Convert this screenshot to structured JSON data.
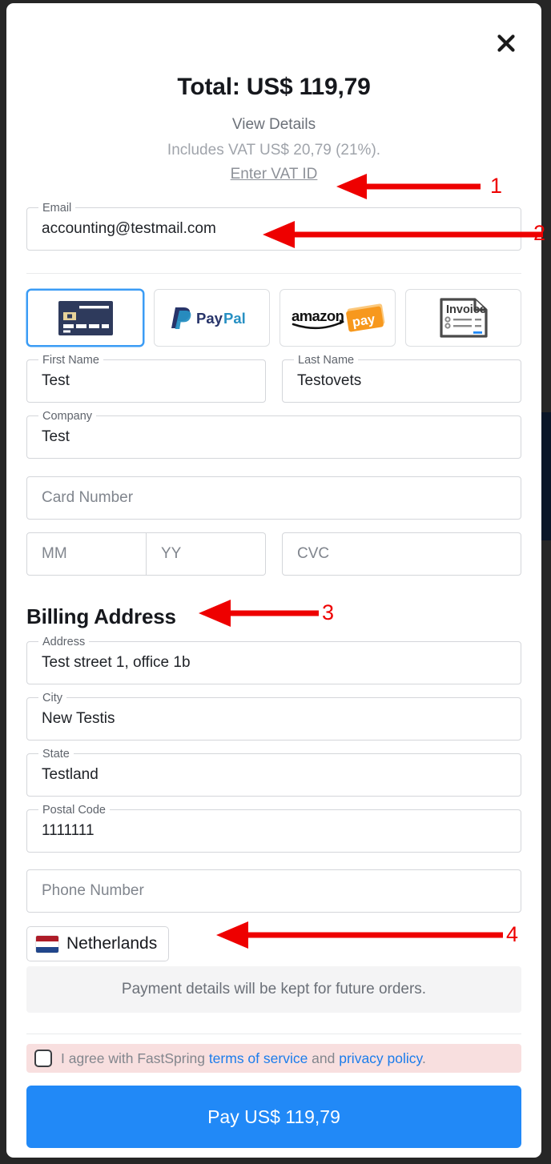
{
  "modal": {
    "close_icon": "close-icon",
    "total_title": "Total: US$ 119,79",
    "view_details": "View Details",
    "vat_line": "Includes VAT US$ 20,79 (21%).",
    "vat_id_link": "Enter VAT ID"
  },
  "email": {
    "label": "Email",
    "value": "accounting@testmail.com"
  },
  "payment_methods": [
    {
      "name": "credit-card",
      "label": "Credit Card",
      "selected": true
    },
    {
      "name": "paypal",
      "label": "PayPal",
      "selected": false
    },
    {
      "name": "amazon-pay",
      "label": "amazon pay",
      "selected": false
    },
    {
      "name": "invoice",
      "label": "Invoice",
      "selected": false
    }
  ],
  "card_form": {
    "first_name": {
      "label": "First Name",
      "value": "Test"
    },
    "last_name": {
      "label": "Last Name",
      "value": "Testovets"
    },
    "company": {
      "label": "Company",
      "value": "Test"
    },
    "card_number": {
      "placeholder": "Card Number",
      "value": ""
    },
    "month": {
      "placeholder": "MM",
      "value": ""
    },
    "year": {
      "placeholder": "YY",
      "value": ""
    },
    "cvc": {
      "placeholder": "CVC",
      "value": ""
    }
  },
  "billing": {
    "title": "Billing Address",
    "address": {
      "label": "Address",
      "value": "Test street 1, office 1b"
    },
    "city": {
      "label": "City",
      "value": "New Testis"
    },
    "state": {
      "label": "State",
      "value": "Testland"
    },
    "postal_code": {
      "label": "Postal Code",
      "value": "1111111"
    },
    "phone": {
      "placeholder": "Phone Number",
      "value": ""
    },
    "country": {
      "value": "Netherlands",
      "flag": "netherlands-flag"
    }
  },
  "notice": "Payment details will be kept for future orders.",
  "terms": {
    "prefix": "I agree with FastSpring ",
    "terms_link": "terms of service",
    "middle": " and ",
    "privacy_link": "privacy policy",
    "suffix": "."
  },
  "pay_button": "Pay US$ 119,79",
  "annotations": [
    {
      "number": "1"
    },
    {
      "number": "2"
    },
    {
      "number": "3"
    },
    {
      "number": "4"
    }
  ],
  "colors": {
    "accent": "#2189f7",
    "selected_border": "#3b9cf5",
    "annotation": "#ee0000",
    "error_bg": "#f8dfdf",
    "link": "#1b7ceb"
  }
}
